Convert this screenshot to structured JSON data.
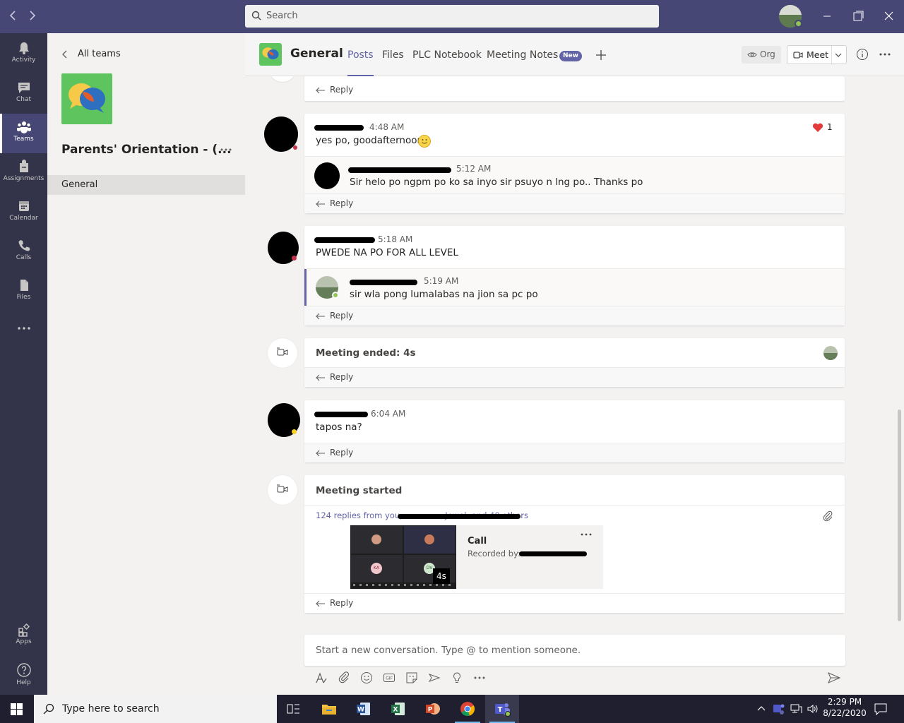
{
  "titlebar": {
    "search_placeholder": "Search"
  },
  "rail": [
    {
      "label": "Activity",
      "icon": "bell-icon"
    },
    {
      "label": "Chat",
      "icon": "chat-icon"
    },
    {
      "label": "Teams",
      "icon": "teams-icon",
      "active": true
    },
    {
      "label": "Assignments",
      "icon": "assignments-icon"
    },
    {
      "label": "Calendar",
      "icon": "calendar-icon"
    },
    {
      "label": "Calls",
      "icon": "phone-icon"
    },
    {
      "label": "Files",
      "icon": "files-icon"
    },
    {
      "label": "Apps",
      "icon": "apps-icon"
    },
    {
      "label": "Help",
      "icon": "help-icon"
    }
  ],
  "team_panel": {
    "back_label": "All teams",
    "team_name": "Parents' Orientation - (...",
    "channels": [
      "General"
    ]
  },
  "header": {
    "channel_name": "General",
    "tabs": [
      "Posts",
      "Files",
      "PLC Notebook",
      "Meeting Notes"
    ],
    "new_badge": "New",
    "org_label": "Org",
    "meet_label": "Meet"
  },
  "posts": [
    {
      "time": "4:48 AM",
      "text": "yes po, goodafternoon",
      "likes": "1",
      "reply": {
        "time": "5:12 AM",
        "text": "Sir helo po ngpm po ko sa inyo sir psuyo n lng po.. Thanks po"
      }
    },
    {
      "time": "5:18 AM",
      "text": "PWEDE NA PO FOR ALL LEVEL",
      "reply": {
        "time": "5:19 AM",
        "text": "sir wla pong lumalabas na jion sa pc po"
      }
    },
    {
      "text": "Meeting ended: 4s"
    },
    {
      "time": "6:04 AM",
      "text": "tapos na?"
    },
    {
      "text": "Meeting started",
      "replies_summary": "124 replies from you,",
      "replies_tail": ", Jewel, and 40 others",
      "call_title": "Call",
      "recorded_by": "Recorded by:",
      "duration": "4s",
      "participant_initials": [
        "KA",
        "DV"
      ]
    }
  ],
  "reply_label": "Reply",
  "composer": {
    "placeholder": "Start a new conversation. Type @ to mention someone."
  },
  "taskbar": {
    "search_placeholder": "Type here to search",
    "time": "2:29 PM",
    "date": "8/22/2020"
  },
  "colors": {
    "brand": "#6264a7",
    "titlebar": "#464775",
    "rail": "#33344a",
    "like_heart": "#e33b3b"
  }
}
